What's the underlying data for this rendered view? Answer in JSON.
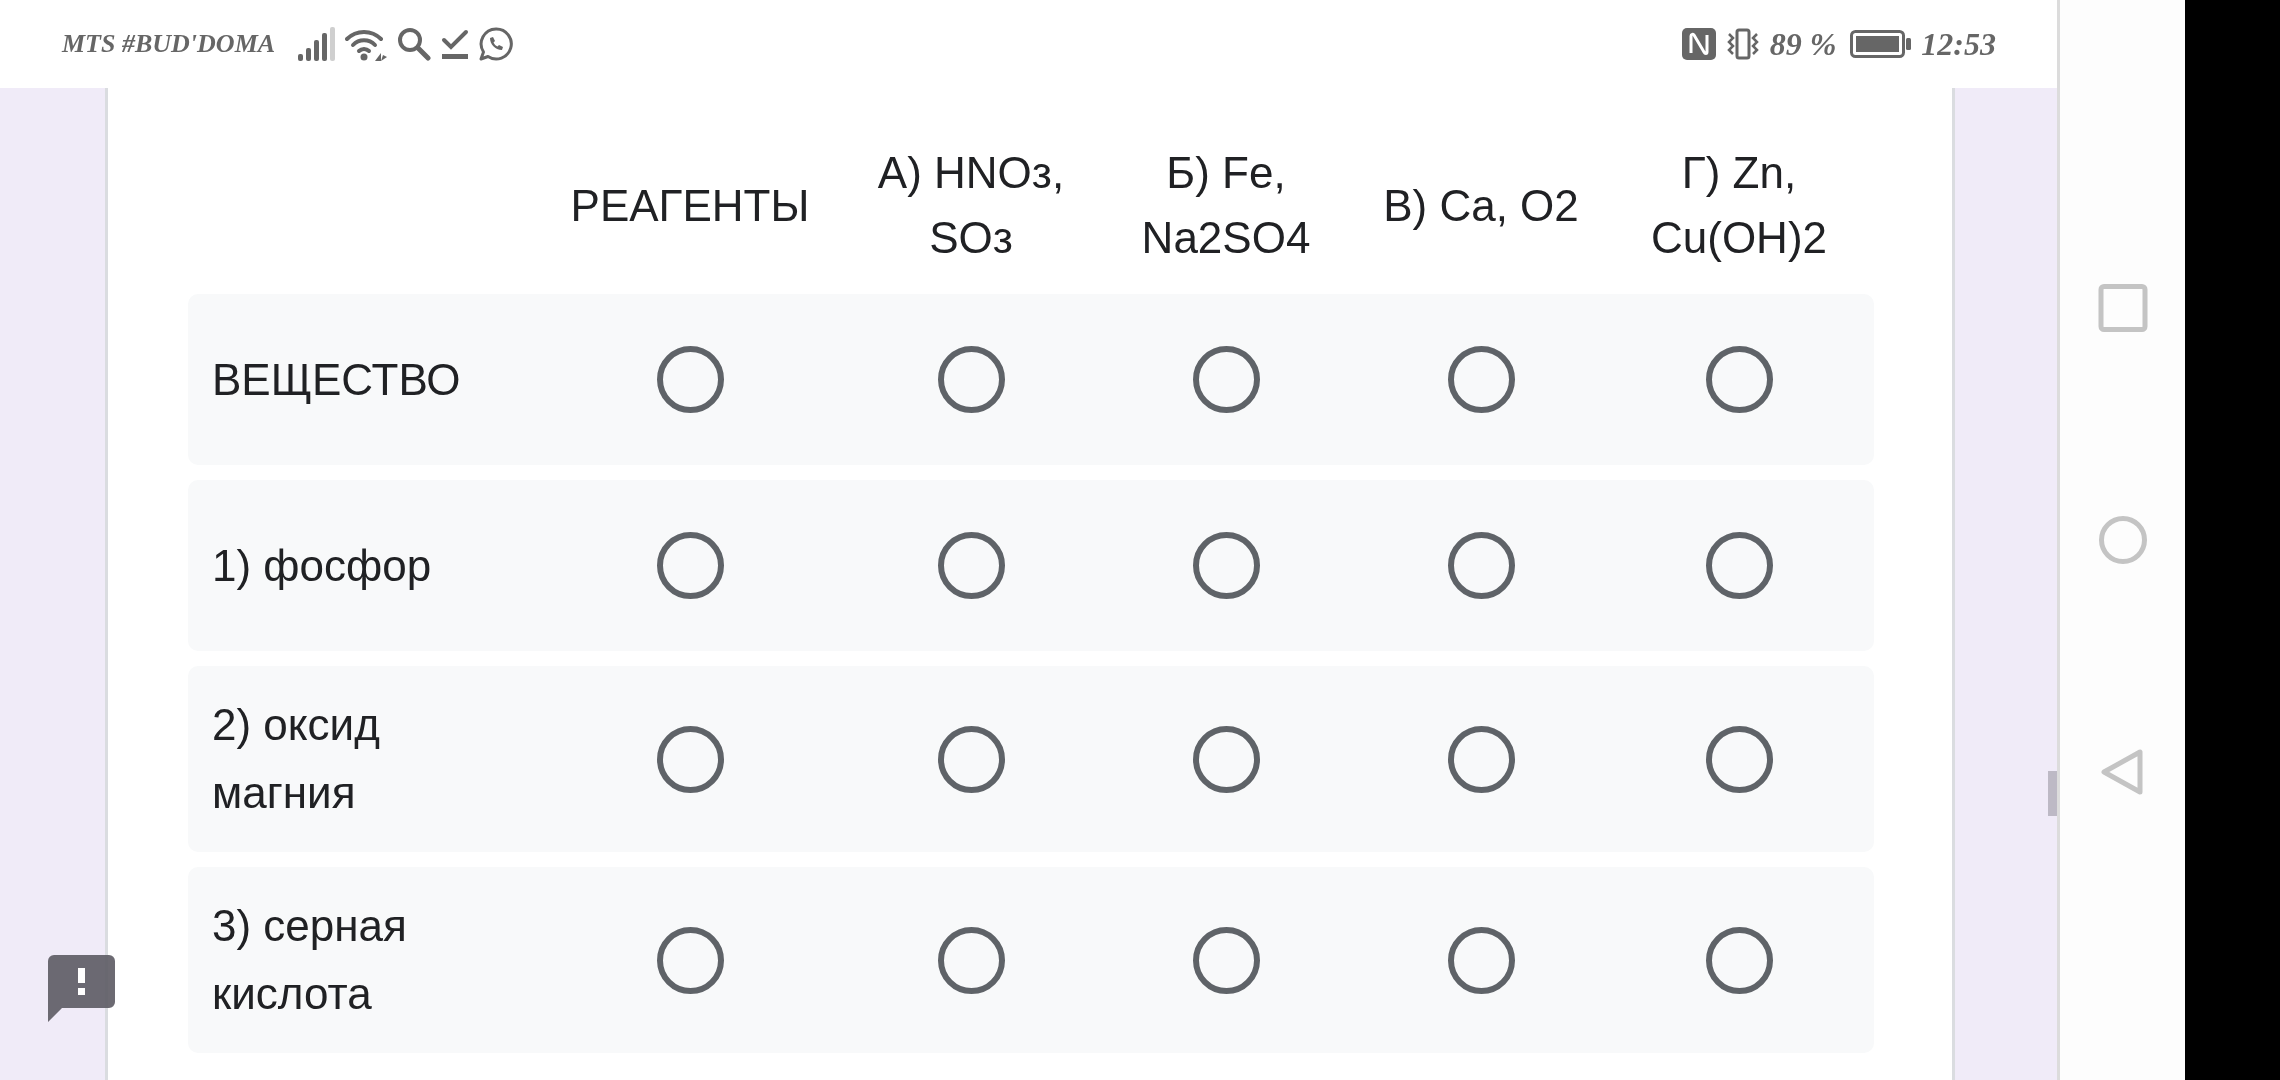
{
  "status_bar": {
    "carrier": "MTS #BUD'DOMA",
    "battery": "89 %",
    "time": "12:53"
  },
  "grid": {
    "columns": [
      "РЕАГЕНТЫ",
      "А) HNOз, SOз",
      "Б) Fe, Na2SO4",
      "В) Ca, O2",
      "Г) Zn, Cu(OH)2"
    ],
    "rows": [
      {
        "label": "ВЕЩЕСТВО",
        "options": [
          {
            "selected": false
          },
          {
            "selected": false
          },
          {
            "selected": false
          },
          {
            "selected": false
          },
          {
            "selected": false
          }
        ]
      },
      {
        "label": "1) фосфор",
        "options": [
          {
            "selected": false
          },
          {
            "selected": false
          },
          {
            "selected": false
          },
          {
            "selected": false
          },
          {
            "selected": false
          }
        ]
      },
      {
        "label": "2) оксид магния",
        "options": [
          {
            "selected": false
          },
          {
            "selected": false
          },
          {
            "selected": false
          },
          {
            "selected": false
          },
          {
            "selected": false
          }
        ]
      },
      {
        "label": "3) серная кислота",
        "options": [
          {
            "selected": false
          },
          {
            "selected": false
          },
          {
            "selected": false
          },
          {
            "selected": false
          },
          {
            "selected": false
          }
        ]
      }
    ]
  }
}
